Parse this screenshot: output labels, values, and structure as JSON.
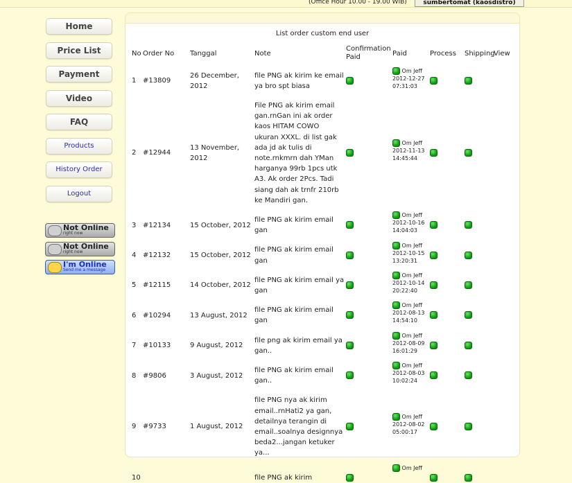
{
  "topbar": {
    "office_hour": "(Office Hour 10.00 - 19.00 WIB)",
    "user_label": "sumbertomat (kaosdistro)"
  },
  "nav": [
    {
      "label": "Home",
      "small": false
    },
    {
      "label": "Price List",
      "small": false
    },
    {
      "label": "Payment",
      "small": false
    },
    {
      "label": "Video",
      "small": false
    },
    {
      "label": "FAQ",
      "small": false
    },
    {
      "label": "Products",
      "small": true
    },
    {
      "label": "History Order",
      "small": true
    },
    {
      "label": "Logout",
      "small": true
    }
  ],
  "status_widgets": [
    {
      "line1": "Not Online",
      "line2": "right now",
      "online": false
    },
    {
      "line1": "Not Online",
      "line2": "right now",
      "online": false
    },
    {
      "line1": "I'm Online",
      "line2": "Send me a message",
      "online": true
    }
  ],
  "table": {
    "title": "List order custom end user",
    "headers": {
      "no": "No",
      "order_no": "Order No",
      "tanggal": "Tanggal",
      "note": "Note",
      "confirmation_paid_1": "Confirmation",
      "confirmation_paid_2": "Paid",
      "paid": "Paid",
      "process": "Process",
      "shipping": "Shipping",
      "view": "View"
    },
    "rows": [
      {
        "no": "1",
        "order": "#13809",
        "date": "26 December, 2012",
        "note": [
          "file PNG ak kirim ke email",
          "ya bro spt biasa"
        ],
        "paid_by": "Om Jeff",
        "paid_date": "2012-12-27",
        "paid_time": "07:31:03"
      },
      {
        "no": "2",
        "order": "#12944",
        "date": "13 November, 2012",
        "note": [
          "File PNG ak kirim email",
          "gan.rnGan ini ak order",
          "kaos HITAM COWO",
          "ukuran XXXL. di list gak",
          "ada jd ak tulis di",
          "note.rnkmrn dah YMan",
          "harganya 99rb 1pcs utk",
          "A3. Ak order 2Pcs. Tadi",
          "siang dah ak trnfr 210rb",
          "ke Mandiri gan."
        ],
        "paid_by": "Om Jeff",
        "paid_date": "2012-11-13",
        "paid_time": "14:45:44"
      },
      {
        "no": "3",
        "order": "#12134",
        "date": "15 October, 2012",
        "note": [
          "file PNG ak kirim email",
          "gan"
        ],
        "paid_by": "Om Jeff",
        "paid_date": "2012-10-16",
        "paid_time": "14:04:03"
      },
      {
        "no": "4",
        "order": "#12132",
        "date": "15 October, 2012",
        "note": [
          "file PNG ak kirim email",
          "gan"
        ],
        "paid_by": "Om Jeff",
        "paid_date": "2012-10-15",
        "paid_time": "13:20:31"
      },
      {
        "no": "5",
        "order": "#12115",
        "date": "14 October, 2012",
        "note": [
          "file PNG ak kirim email ya",
          "gan"
        ],
        "paid_by": "Om Jeff",
        "paid_date": "2012-10-14",
        "paid_time": "20:22:40"
      },
      {
        "no": "6",
        "order": "#10294",
        "date": "13 August, 2012",
        "note": [
          "file PNG ak kirim email",
          "gan"
        ],
        "paid_by": "Om Jeff",
        "paid_date": "2012-08-13",
        "paid_time": "14:54:10"
      },
      {
        "no": "7",
        "order": "#10133",
        "date": "9 August, 2012",
        "note": [
          "file png ak kirim email ya",
          "gan.."
        ],
        "paid_by": "Om Jeff",
        "paid_date": "2012-08-09",
        "paid_time": "16:01:29"
      },
      {
        "no": "8",
        "order": "#9806",
        "date": "3 August, 2012",
        "note": [
          "file PNG ak kirim email",
          "gan.."
        ],
        "paid_by": "Om Jeff",
        "paid_date": "2012-08-03",
        "paid_time": "10:02:24"
      },
      {
        "no": "9",
        "order": "#9733",
        "date": "1 August, 2012",
        "note": [
          "file PNG nya ak kirim",
          "email..rnHati2 ya gan,",
          "detailnya terangin di",
          "email..soalnya designnya",
          "beda2...jangan ketuker",
          "ya..."
        ],
        "paid_by": "Om Jeff",
        "paid_date": "2012-08-02",
        "paid_time": "05:00:17"
      },
      {
        "no": "10",
        "order": "",
        "date": "",
        "note": [
          "file PNG ak kirim"
        ],
        "paid_by": "Om Jeff",
        "paid_date": "",
        "paid_time": ""
      }
    ]
  }
}
